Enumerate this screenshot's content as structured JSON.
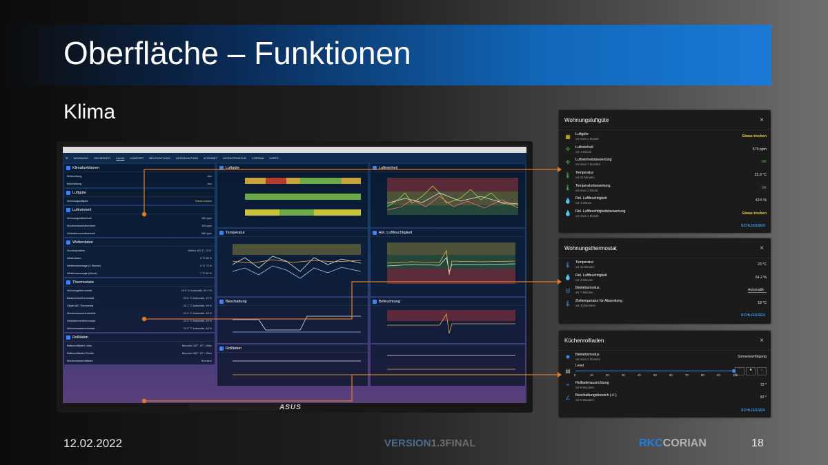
{
  "slide": {
    "title": "Oberfläche – Funktionen",
    "subtitle": "Klima",
    "date": "12.02.2022",
    "version_a": "VERSION",
    "version_b": "1.3FINAL",
    "brand_a": "RKC",
    "brand_b": "CORIAN",
    "page": "18"
  },
  "monitor": {
    "brand": "ASUS",
    "nav_tabs": [
      "WOHNUNG",
      "SICHERHEIT",
      "KLIMA",
      "KOMFORT",
      "BELEUCHTUNG",
      "UNTERHALTUNG",
      "INTERNET",
      "INFRASTRUKTUR",
      "CORONA",
      "KARTE"
    ],
    "col1": [
      {
        "title": "Klimafunktionen",
        "rows": [
          {
            "label": "Befeuchtung",
            "value": "Aus"
          },
          {
            "label": "Beschattung",
            "value": "Aus"
          }
        ]
      },
      {
        "title": "Luftgüte",
        "rows": [
          {
            "label": "Wohnungsluftgüte",
            "value": "Etwas trocken",
            "warn": true
          }
        ]
      },
      {
        "title": "Luftreinheit",
        "rows": [
          {
            "label": "Wohnungsluftreinheit",
            "value": "580 ppm"
          },
          {
            "label": "Kinderzimmerluftreinheit",
            "value": "300 ppm"
          },
          {
            "label": "Schlafzimmerluftreinheit",
            "value": "580 ppm"
          }
        ]
      },
      {
        "title": "Wetterdaten",
        "rows": [
          {
            "label": "Sonnenposition",
            "value": "Östlich 167.3°, 23.5°"
          },
          {
            "label": "Wetterdaten",
            "value": "5 °C 66 %"
          },
          {
            "label": "Wettervorhersage (1 Stunde)",
            "value": "4 °C 73 %"
          },
          {
            "label": "Wettervorhersage (Heute)",
            "value": "7 °C 81 %"
          }
        ]
      },
      {
        "title": "Thermostate",
        "rows": [
          {
            "label": "Wohnungsthermostat",
            "value": "22.9 °C Automatik, 64.2 %"
          },
          {
            "label": "Badezimmerthermostat",
            "value": "23.6 °C Automatik, 49 %"
          },
          {
            "label": "Gäste-WC-Thermostat",
            "value": "23.1 °C Automatik, 46 %"
          },
          {
            "label": "Kinderzimmerthermostat",
            "value": "22.9 °C Automatik, 48 %"
          },
          {
            "label": "Schlafzimmerthermostat",
            "value": "22.9 °C Automatik, 48 %"
          },
          {
            "label": "Wohnzimmerthermostat",
            "value": "22.9 °C Automatik, 48 %"
          }
        ]
      },
      {
        "title": "Rollläden",
        "rows": [
          {
            "label": "Balkonrollladen Links",
            "value": "Benutzer 162°, 67°, Oben"
          },
          {
            "label": "Balkonrollladen Rechts",
            "value": "Benutzer 162°, 67°, Oben"
          },
          {
            "label": "Kinderzimmerrollladen",
            "value": "Benutzer"
          }
        ]
      }
    ],
    "cards": [
      "Luftgüte",
      "Luftreinheit",
      "Temperatur",
      "Rel. Luftfeuchtigkeit",
      "Beschattung",
      "Befeuchtung",
      "Rollläden"
    ]
  },
  "dialogs": {
    "luftguete": {
      "title": "Wohnungsluftgüte",
      "close": "×",
      "rows": [
        {
          "icon": "grid-icon",
          "name": "Luftgüte",
          "sub": "vor etwa 1 Stunde",
          "value": "Etwas trocken",
          "style": "warn"
        },
        {
          "icon": "fan-icon",
          "name": "Luftreinheit",
          "sub": "vor 1 Minute",
          "value": "570 ppm",
          "style": ""
        },
        {
          "icon": "fan-icon",
          "name": "Luftreinheitsbewertung",
          "sub": "vor etwa 7 Stunden",
          "value": "OK",
          "style": "good"
        },
        {
          "icon": "thermometer-icon",
          "name": "Temperatur",
          "sub": "vor 22 Minuten",
          "value": "22.9 °C",
          "style": ""
        },
        {
          "icon": "thermometer-icon",
          "name": "Temperaturbewertung",
          "sub": "vor etwa 1 Monat",
          "value": "OK",
          "style": "good"
        },
        {
          "icon": "drop-icon",
          "name": "Rel. Luftfeuchtigkeit",
          "sub": "vor 1 Minute",
          "value": "43.5 %",
          "style": ""
        },
        {
          "icon": "drop-icon",
          "name": "Rel. Luftfeuchtigkeitsbewertung",
          "sub": "vor etwa 1 Stunde",
          "value": "Etwas trocken",
          "style": "warn"
        }
      ],
      "footer": "SCHLIESSEN"
    },
    "thermostat": {
      "title": "Wohnungsthermostat",
      "close": "×",
      "rows": [
        {
          "icon": "thermometer-icon",
          "name": "Temperatur",
          "sub": "vor 16 Minuten",
          "value": "23 °C"
        },
        {
          "icon": "drop-icon",
          "name": "Rel. Luftfeuchtigkeit",
          "sub": "vor 3 Minuten",
          "value": "64.2 %"
        },
        {
          "icon": "mode-icon",
          "name": "Betriebsmodus",
          "sub": "vor 7 Minuten",
          "value": "Automatik"
        },
        {
          "icon": "thermometer-icon",
          "name": "Zieltemperatur für Absenkung",
          "sub": "vor 10 Monaten",
          "value": "18 °C"
        }
      ],
      "footer": "SCHLIESSEN"
    },
    "rollladen": {
      "title": "Küchenrollladen",
      "close": "×",
      "mode_name": "Betriebsmodus",
      "mode_sub": "vor etwa 2 Stunden",
      "mode_value": "Sonnenverfolgung",
      "level_label": "Level",
      "level_value": 100,
      "ticks": [
        "0",
        "10",
        "20",
        "30",
        "40",
        "50",
        "60",
        "70",
        "80",
        "90",
        "100"
      ],
      "orient_name": "Rollladenausrichtung",
      "orient_sub": "vor 8 Monaten",
      "orient_value": "72 °",
      "shade_name": "Beschattungsbereich (+/-)",
      "shade_sub": "vor 8 Monaten",
      "shade_value": "63 °",
      "footer": "SCHLIESSEN"
    }
  },
  "colors": {
    "accent": "#1f7ee0",
    "connector": "#e07a2a",
    "warn": "#f2d23a",
    "good": "#5ec85e"
  }
}
